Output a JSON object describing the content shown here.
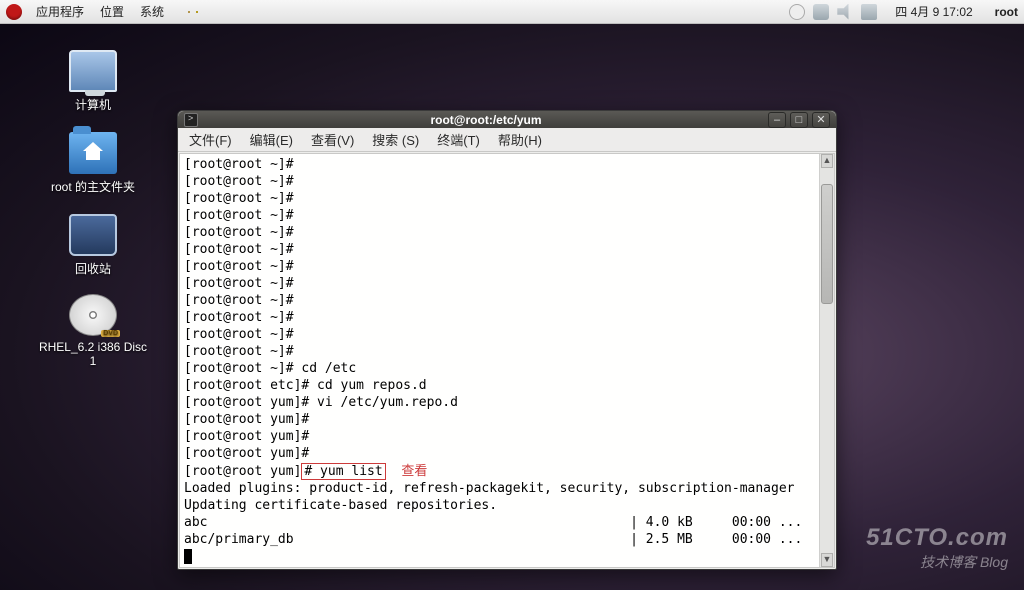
{
  "panel": {
    "menus": [
      "应用程序",
      "位置",
      "系统"
    ],
    "clock": "四 4月  9 17:02",
    "user": "root"
  },
  "desktop_icons": {
    "computer": "计算机",
    "home": "root 的主文件夹",
    "trash": "回收站",
    "disc": "RHEL_6.2 i386 Disc 1"
  },
  "terminal": {
    "title": "root@root:/etc/yum",
    "menus": {
      "file": "文件(F)",
      "edit": "编辑(E)",
      "view": "查看(V)",
      "search": "搜索 (S)",
      "term": "终端(T)",
      "help": "帮助(H)"
    },
    "prompt_empty": "[root@root ~]#",
    "lines": {
      "cd_etc": "[root@root ~]# cd /etc",
      "cd_yum": "[root@root etc]# cd yum repos.d",
      "vi": "[root@root yum]# vi /etc/yum.repo.d",
      "yum_p": "[root@root yum]#",
      "yum_list_prompt": "[root@root yum]",
      "yum_list_cmd": "# yum list",
      "annot": "查看",
      "loaded": "Loaded plugins: product-id, refresh-packagekit, security, subscription-manager",
      "updating": "Updating certificate-based repositories.",
      "abc": "abc                                                      | 4.0 kB     00:00 ...",
      "abc_db": "abc/primary_db                                           | 2.5 MB     00:00 ..."
    }
  },
  "watermark": {
    "big": "51CTO.com",
    "small": "技术博客  Blog"
  }
}
